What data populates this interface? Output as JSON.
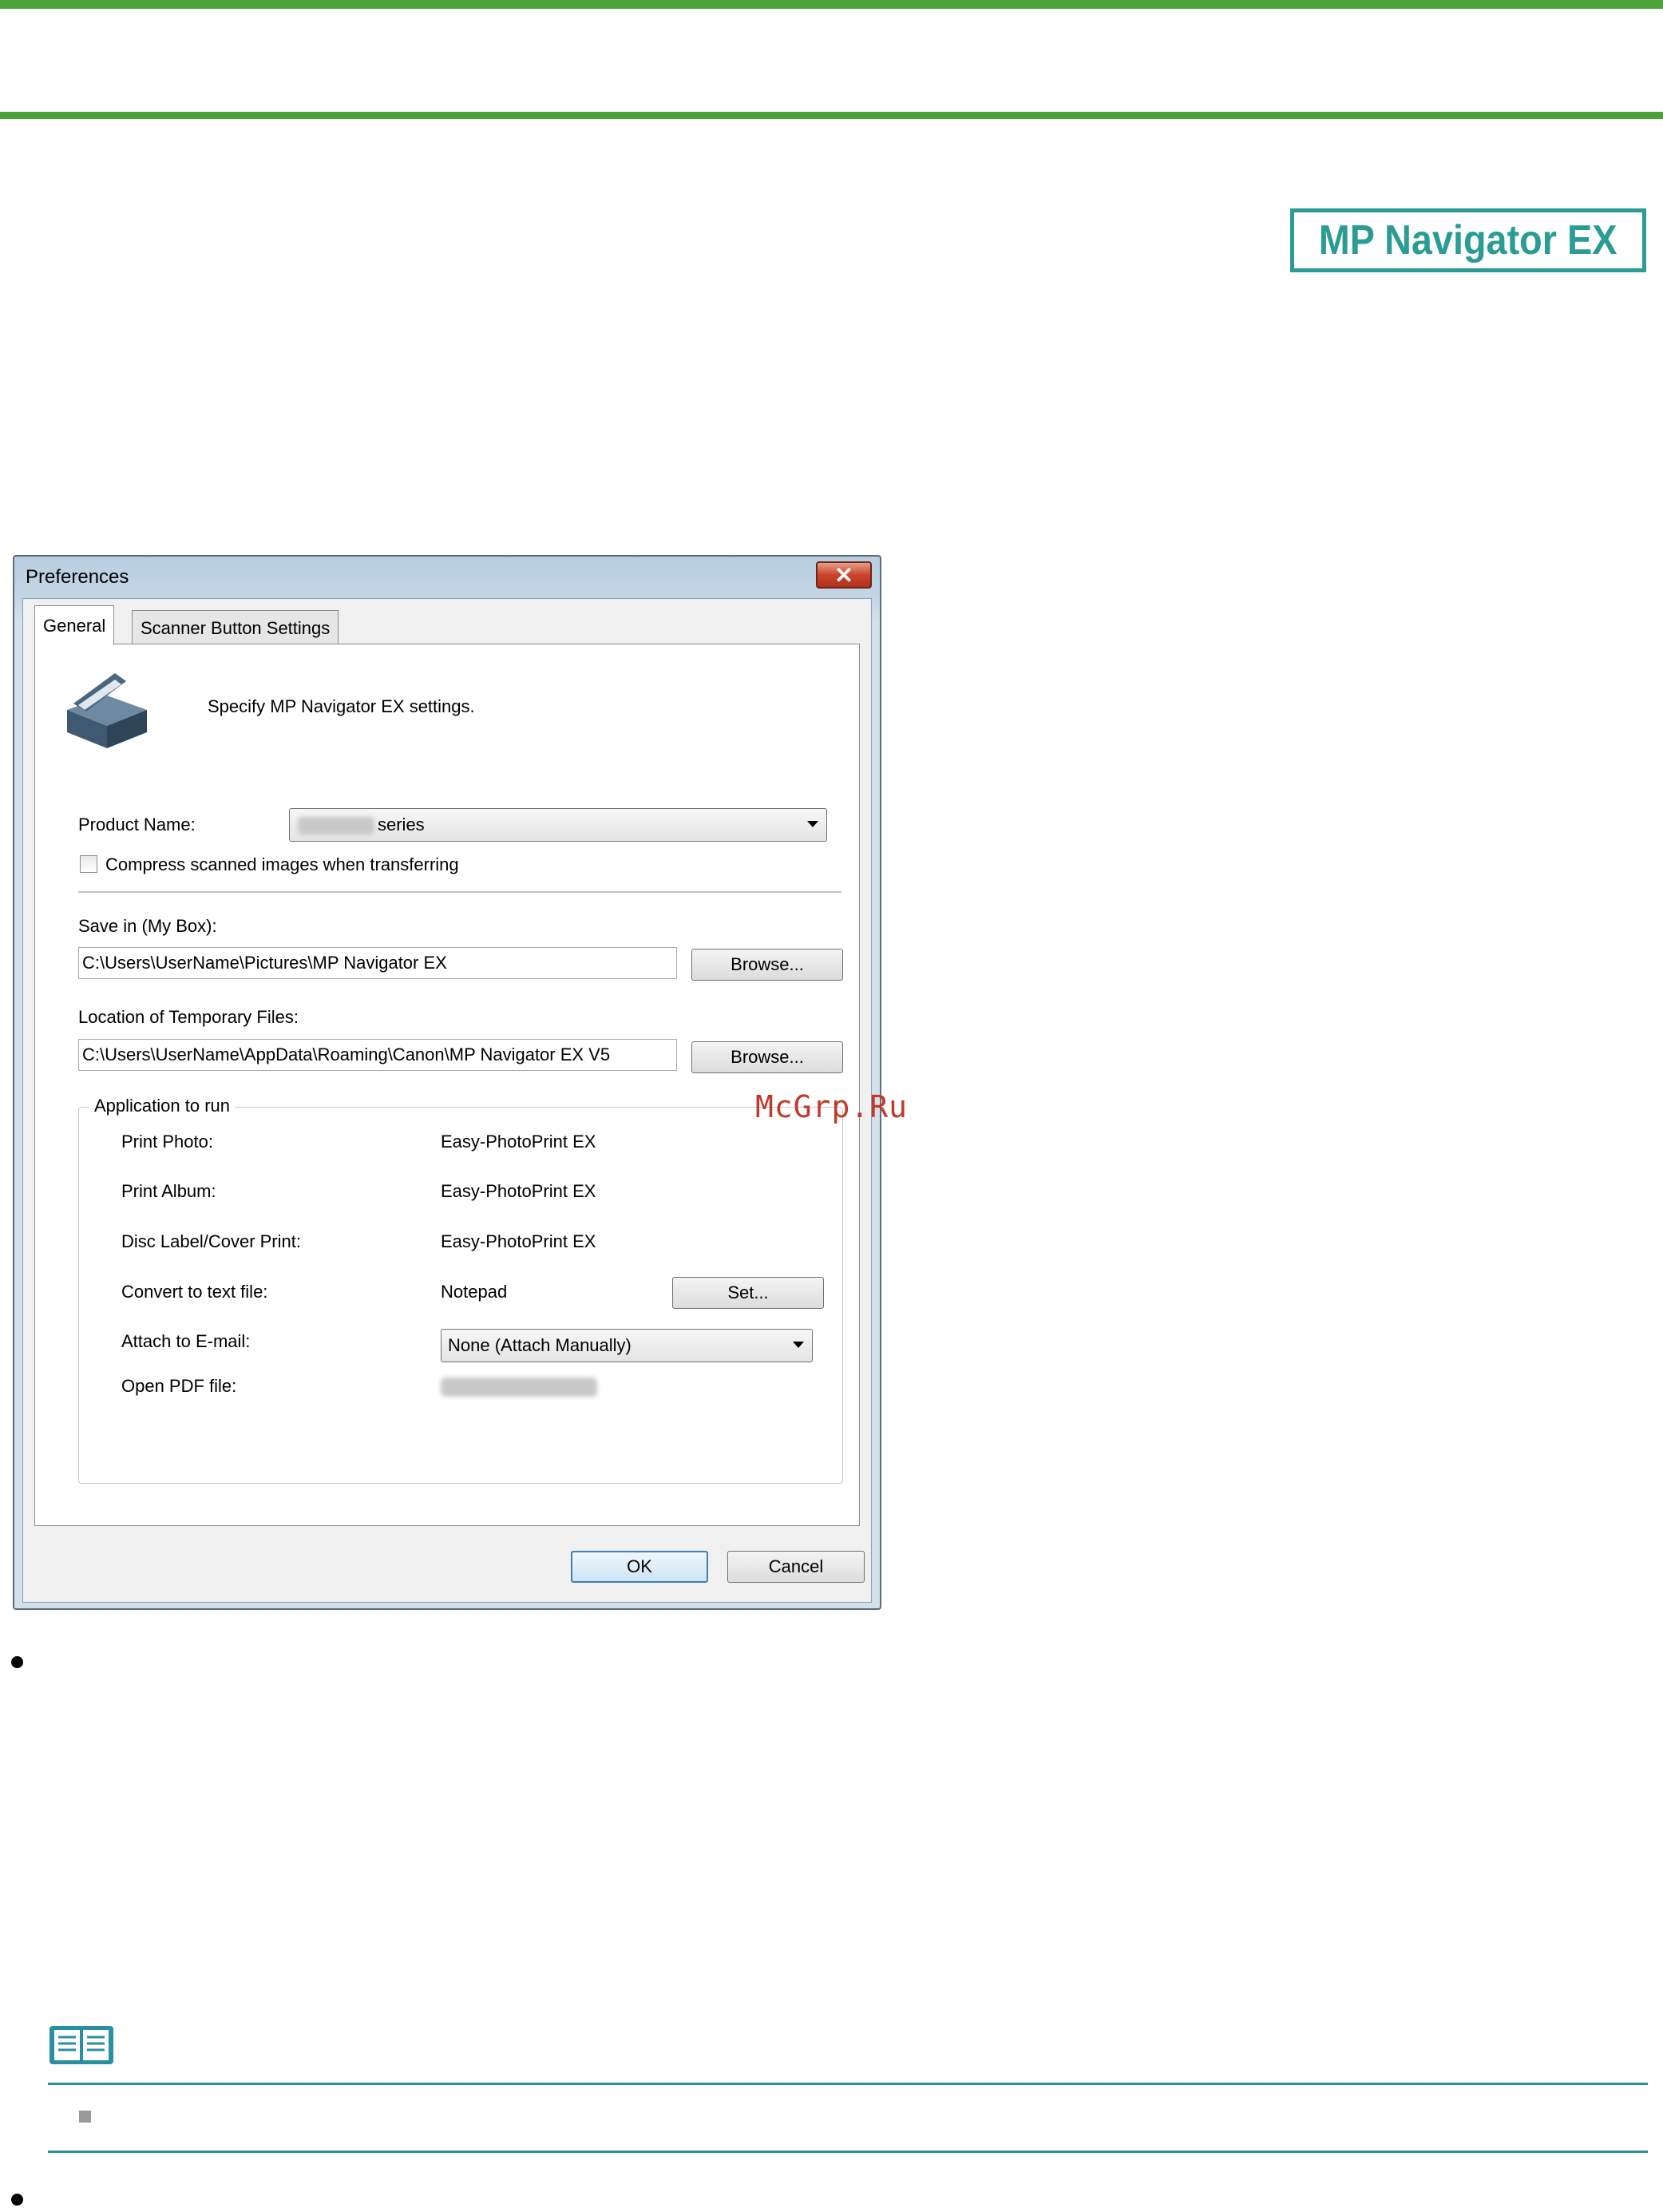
{
  "page": {
    "product_badge": "MP Navigator EX",
    "watermark": "McGrp.Ru",
    "colors": {
      "green_rule": "#4ba23a",
      "teal": "#2a9c93",
      "note_rule": "#2a8fa0"
    }
  },
  "dialog": {
    "title": "Preferences",
    "close_icon": "close-icon",
    "tabs": [
      {
        "label": "General",
        "active": true
      },
      {
        "label": "Scanner Button Settings",
        "active": false
      }
    ],
    "header_text": "Specify MP Navigator EX settings.",
    "product_name_label": "Product Name:",
    "product_name_value": "series",
    "compress_checkbox_label": "Compress scanned images when transferring",
    "compress_checked": false,
    "save_in_label": "Save in (My Box):",
    "save_in_value": "C:\\Users\\UserName\\Pictures\\MP Navigator EX",
    "browse_label": "Browse...",
    "temp_files_label": "Location of Temporary Files:",
    "temp_files_value": "C:\\Users\\UserName\\AppData\\Roaming\\Canon\\MP Navigator EX V5",
    "app_group_title": "Application to run",
    "apps": [
      {
        "label": "Print Photo:",
        "value": "Easy-PhotoPrint EX"
      },
      {
        "label": "Print Album:",
        "value": "Easy-PhotoPrint EX"
      },
      {
        "label": "Disc Label/Cover Print:",
        "value": "Easy-PhotoPrint EX"
      },
      {
        "label": "Convert to text file:",
        "value": "Notepad"
      },
      {
        "label": "Attach to E-mail:",
        "value": "None (Attach Manually)"
      },
      {
        "label": "Open PDF file:",
        "value": ""
      }
    ],
    "set_label": "Set...",
    "ok_label": "OK",
    "cancel_label": "Cancel"
  }
}
